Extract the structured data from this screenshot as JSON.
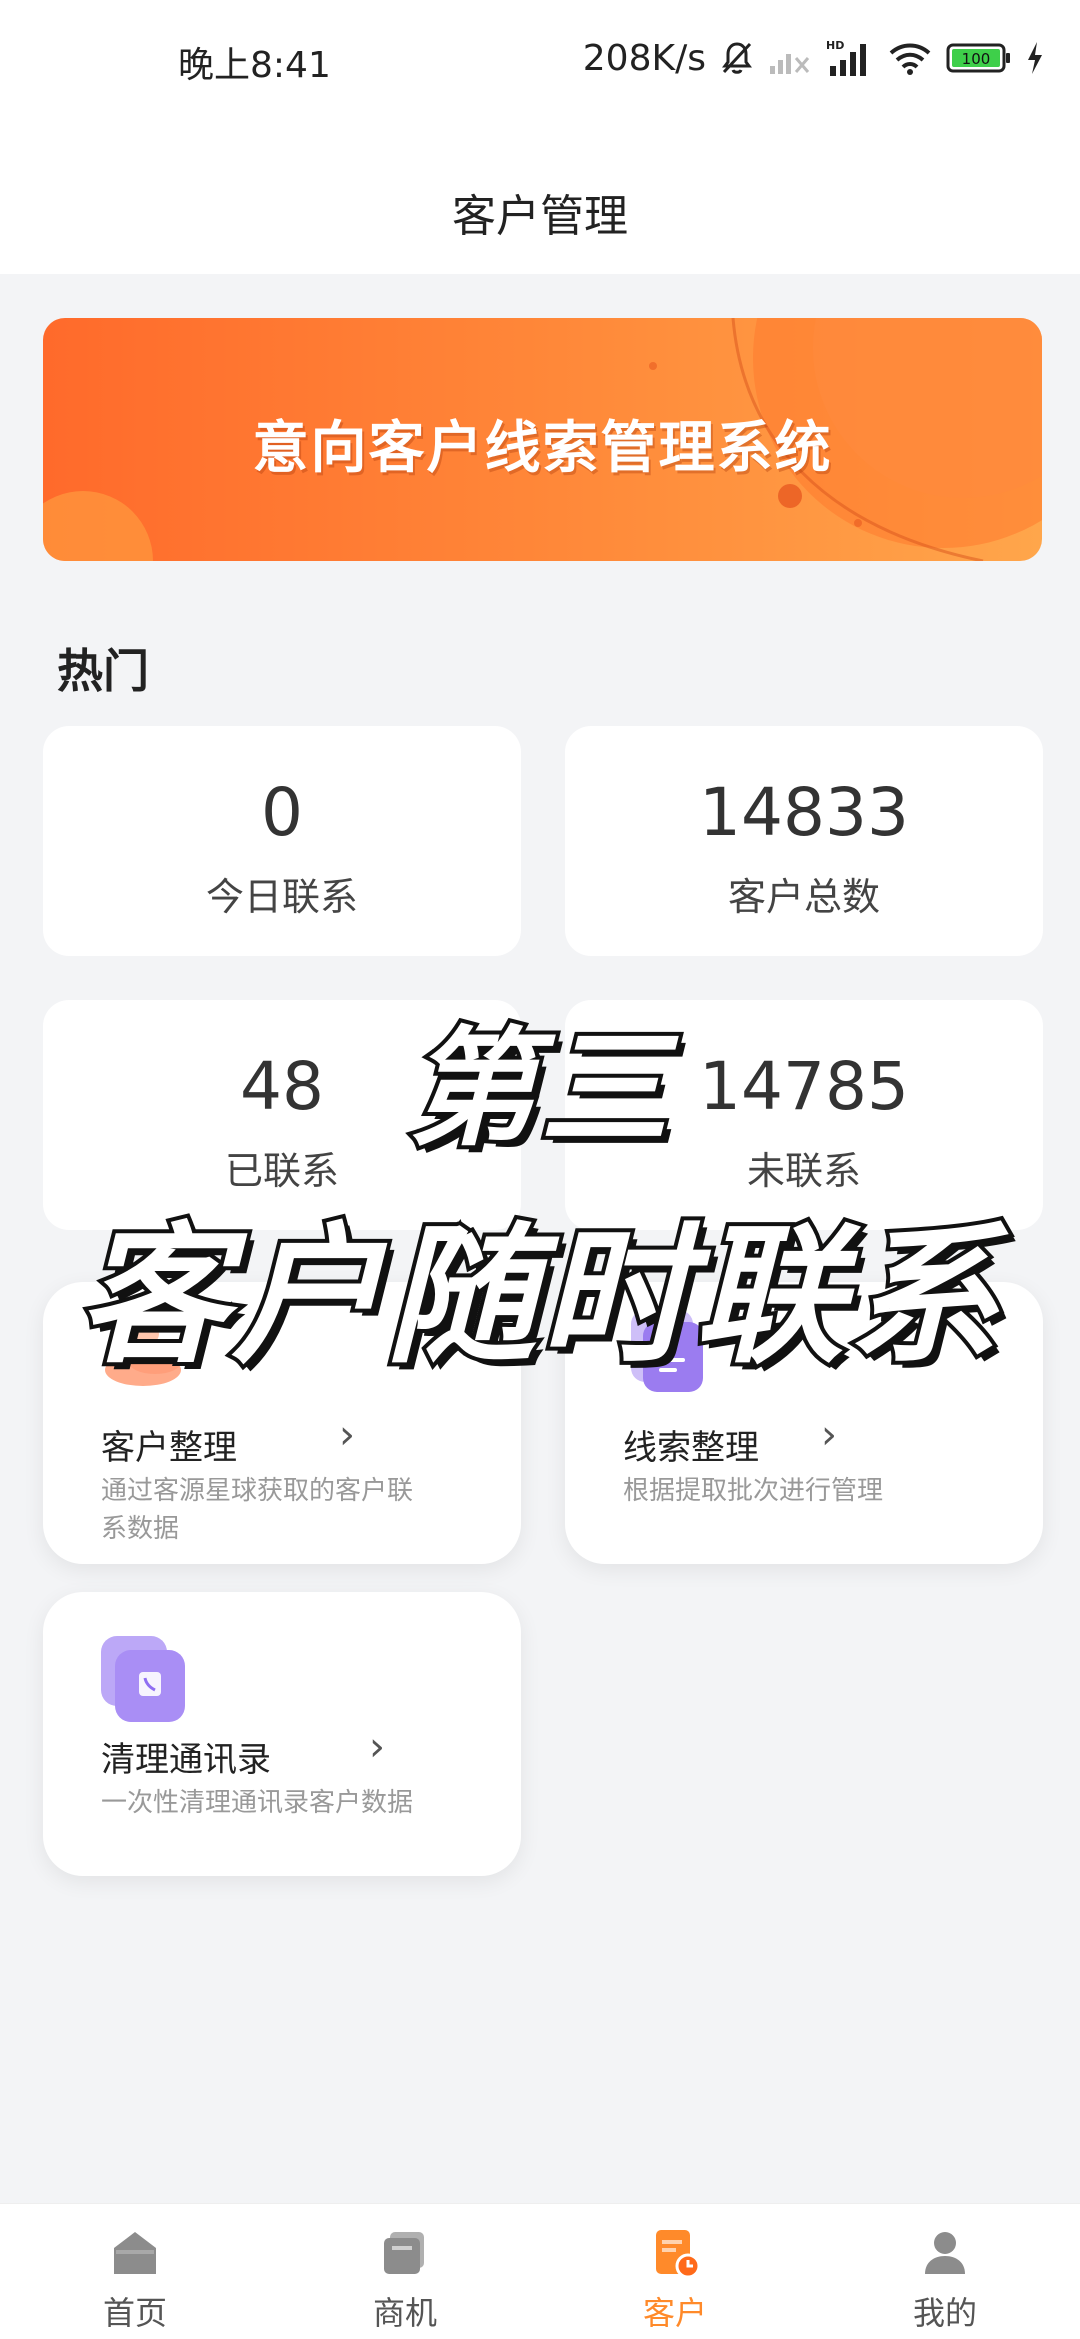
{
  "status_bar": {
    "time": "晚上8:41",
    "net_speed": "208K/s",
    "battery": "100"
  },
  "header": {
    "title": "客户管理"
  },
  "banner": {
    "text": "意向客户线索管理系统"
  },
  "hot": {
    "title": "热门",
    "stats": [
      {
        "value": "0",
        "label": "今日联系"
      },
      {
        "value": "14833",
        "label": "客户总数"
      },
      {
        "value": "48",
        "label": "已联系"
      },
      {
        "value": "14785",
        "label": "未联系"
      }
    ]
  },
  "features": [
    {
      "title": "客户整理",
      "desc": "通过客源星球获取的客户联系数据",
      "icon": "people-icon"
    },
    {
      "title": "线索整理",
      "desc": "根据提取批次进行管理",
      "icon": "document-icon"
    },
    {
      "title": "清理通讯录",
      "desc": "一次性清理通讯录客户数据",
      "icon": "contacts-icon"
    }
  ],
  "overlay": {
    "line1": "第三",
    "line2": "客户随时联系"
  },
  "bottom_nav": [
    {
      "label": "首页",
      "icon": "home-icon",
      "active": false
    },
    {
      "label": "商机",
      "icon": "opportunity-icon",
      "active": false
    },
    {
      "label": "客户",
      "icon": "customer-icon",
      "active": true
    },
    {
      "label": "我的",
      "icon": "profile-icon",
      "active": false
    }
  ],
  "colors": {
    "accent": "#ff8a2a",
    "banner_start": "#ff6a2b",
    "banner_end": "#ffa64b",
    "page_bg": "#f3f4f6"
  }
}
